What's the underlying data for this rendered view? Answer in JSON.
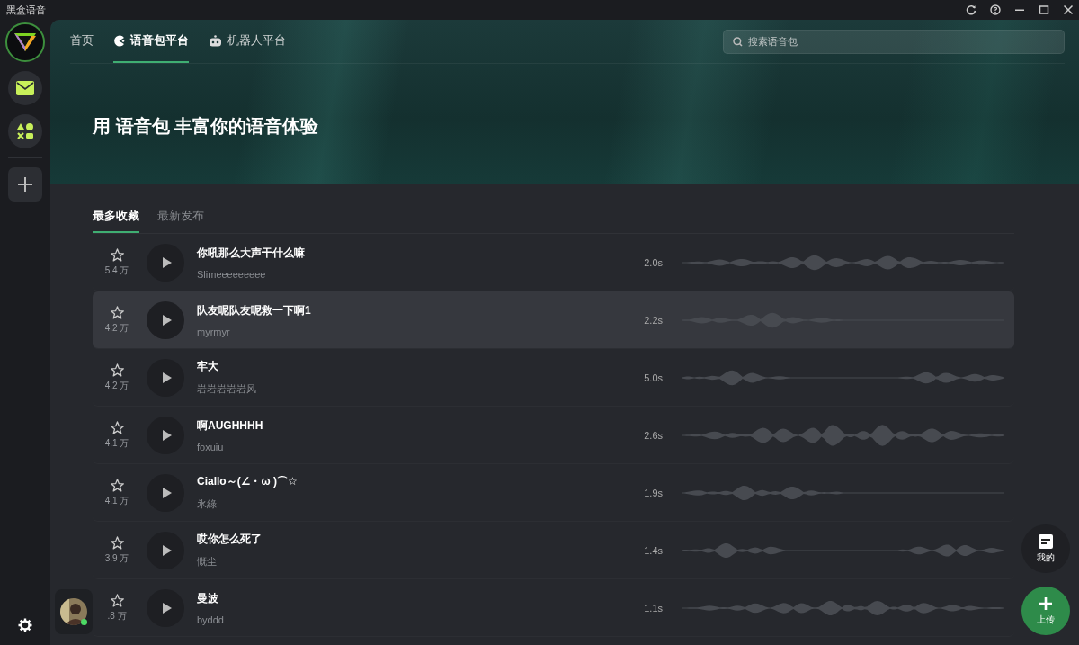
{
  "window": {
    "title": "黑盒语音"
  },
  "nav_tabs": [
    {
      "label": "首页",
      "selected": false
    },
    {
      "label": "语音包平台",
      "selected": true
    },
    {
      "label": "机器人平台",
      "selected": false
    }
  ],
  "search": {
    "placeholder": "搜索语音包"
  },
  "banner": {
    "headline": "用 语音包 丰富你的语音体验"
  },
  "list_tabs": [
    {
      "label": "最多收藏",
      "selected": true
    },
    {
      "label": "最新发布",
      "selected": false
    }
  ],
  "voice_packs": [
    {
      "title": "你吼那么大声干什么嘛",
      "author": "Slimeeeeeeeee",
      "favorites": "5.4 万",
      "duration": "2.0s",
      "selected": false
    },
    {
      "title": "队友呢队友呢救一下啊1",
      "author": "myrmyr",
      "favorites": "4.2 万",
      "duration": "2.2s",
      "selected": true
    },
    {
      "title": "牢大",
      "author": "岩岩岩岩岩风",
      "favorites": "4.2 万",
      "duration": "5.0s",
      "selected": false
    },
    {
      "title": "啊AUGHHHH",
      "author": "foxuiu",
      "favorites": "4.1 万",
      "duration": "2.6s",
      "selected": false
    },
    {
      "title": "Ciallo～(∠・ω )⌒☆",
      "author": "氷綠",
      "favorites": "4.1 万",
      "duration": "1.9s",
      "selected": false
    },
    {
      "title": "哎你怎么死了",
      "author": "慨尘",
      "favorites": "3.9 万",
      "duration": "1.4s",
      "selected": false
    },
    {
      "title": "曼波",
      "author": "byddd",
      "favorites": ".8 万",
      "duration": "1.1s",
      "selected": false
    }
  ],
  "user": {
    "online": true
  },
  "fab_buttons": [
    {
      "kind": "mine",
      "label": "我的"
    },
    {
      "kind": "upload",
      "label": "上传"
    }
  ]
}
